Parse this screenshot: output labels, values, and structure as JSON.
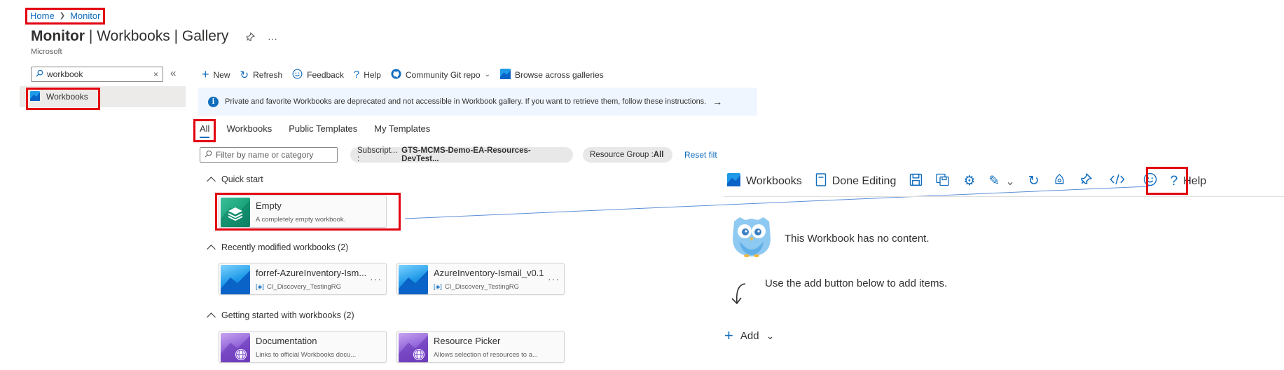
{
  "breadcrumb": {
    "home": "Home",
    "monitor": "Monitor"
  },
  "header": {
    "title_main": "Monitor",
    "title_rest": " | Workbooks | Gallery",
    "subtitle": "Microsoft",
    "pin_icon": "pin-icon",
    "more": "···"
  },
  "left_pane": {
    "search_value": "workbook",
    "clear": "×",
    "collapse": "«",
    "item": "Workbooks"
  },
  "toolbar": {
    "new": "New",
    "refresh": "Refresh",
    "feedback": "Feedback",
    "help": "Help",
    "community": "Community Git repo",
    "browse": "Browse across galleries"
  },
  "banner": {
    "text": "Private and favorite Workbooks are deprecated and not accessible in Workbook gallery. If you want to retrieve them, follow these instructions.",
    "arrow": "→"
  },
  "tabs": [
    "All",
    "Workbooks",
    "Public Templates",
    "My Templates"
  ],
  "filter": {
    "placeholder": "Filter by name or category",
    "subscription_label": "Subscript... : ",
    "subscription_value": "GTS-MCMS-Demo-EA-Resources-DevTest...",
    "resource_group_label": "Resource Group : ",
    "resource_group_value": "All",
    "reset": "Reset filt"
  },
  "sections": {
    "quick_start": "Quick start",
    "recent": "Recently modified workbooks (2)",
    "getting_started": "Getting started with workbooks (2)"
  },
  "cards": {
    "empty": {
      "name": "Empty",
      "desc": "A completely empty workbook."
    },
    "recent1": {
      "name": "forref-AzureInventory-Ism...",
      "desc": "CI_Discovery_TestingRG"
    },
    "recent2": {
      "name": "AzureInventory-Ismail_v0.1",
      "desc": "CI_Discovery_TestingRG"
    },
    "docs": {
      "name": "Documentation",
      "desc": "Links to official Workbooks docu..."
    },
    "picker": {
      "name": "Resource Picker",
      "desc": "Allows selection of resources to a..."
    },
    "more": "···"
  },
  "editor": {
    "workbooks": "Workbooks",
    "done_editing": "Done Editing",
    "help": "Help",
    "no_content": "This Workbook has no content.",
    "use_add": "Use the add button below to add items.",
    "add": "Add"
  },
  "colors": {
    "accent": "#0f6cbd",
    "highlight": "#e3000f"
  }
}
